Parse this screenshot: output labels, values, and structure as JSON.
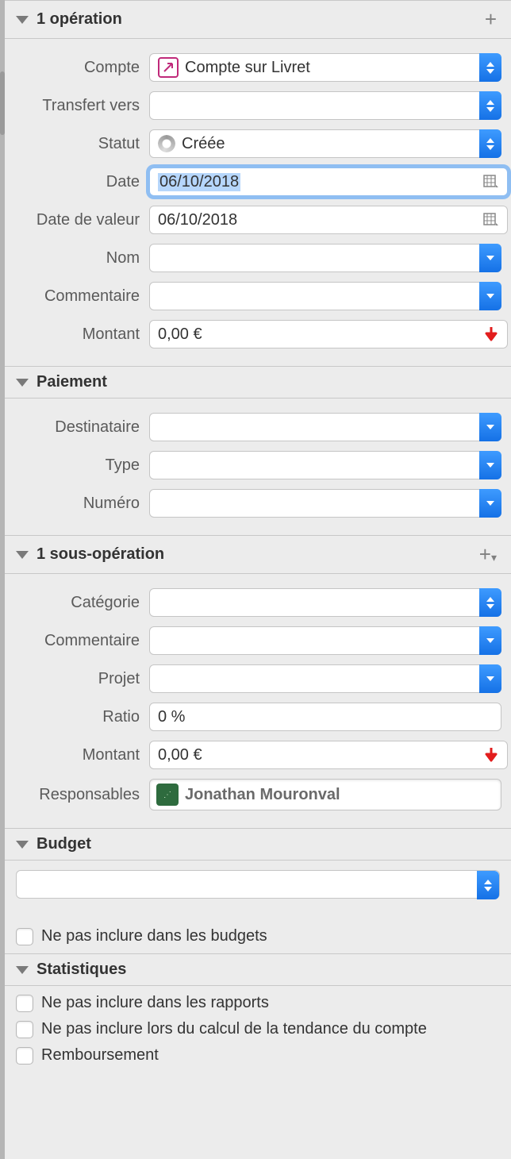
{
  "sections": {
    "operation": {
      "title": "1 opération"
    },
    "paiement": {
      "title": "Paiement"
    },
    "sous": {
      "title": "1 sous-opération"
    },
    "budget": {
      "title": "Budget"
    },
    "stats": {
      "title": "Statistiques"
    }
  },
  "operation": {
    "labels": {
      "compte": "Compte",
      "transfert": "Transfert vers",
      "statut": "Statut",
      "date": "Date",
      "date_valeur": "Date de valeur",
      "nom": "Nom",
      "commentaire": "Commentaire",
      "montant": "Montant"
    },
    "values": {
      "compte": "Compte sur Livret",
      "transfert": "",
      "statut": "Créée",
      "date": "06/10/2018",
      "date_valeur": "06/10/2018",
      "nom": "",
      "commentaire": "",
      "montant": "0,00 €"
    }
  },
  "paiement": {
    "labels": {
      "destinataire": "Destinataire",
      "type": "Type",
      "numero": "Numéro"
    },
    "values": {
      "destinataire": "",
      "type": "",
      "numero": ""
    }
  },
  "sous": {
    "labels": {
      "categorie": "Catégorie",
      "commentaire": "Commentaire",
      "projet": "Projet",
      "ratio": "Ratio",
      "montant": "Montant",
      "responsables": "Responsables"
    },
    "values": {
      "categorie": "",
      "commentaire": "",
      "projet": "",
      "ratio": "0 %",
      "montant": "0,00 €",
      "responsable": "Jonathan Mouronval"
    }
  },
  "budget": {
    "exclude_label": "Ne pas inclure dans les budgets",
    "select_value": ""
  },
  "stats": {
    "exclude_reports": "Ne pas inclure dans les rapports",
    "exclude_trend": "Ne pas inclure lors du calcul de la tendance du compte",
    "remboursement": "Remboursement"
  }
}
